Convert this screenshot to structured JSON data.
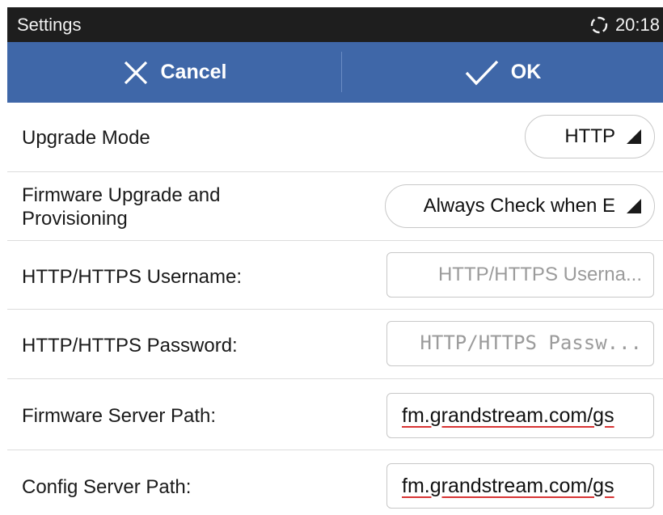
{
  "status_bar": {
    "title": "Settings",
    "time": "20:18",
    "sync_icon": "sync-icon"
  },
  "action_bar": {
    "cancel_label": "Cancel",
    "ok_label": "OK",
    "color": "#3f67a8"
  },
  "rows": {
    "upgrade_mode": {
      "label": "Upgrade Mode",
      "value": "HTTP"
    },
    "firmware_upgrade": {
      "label_line1": "Firmware Upgrade and",
      "label_line2": "Provisioning",
      "value": "Always Check when E"
    },
    "http_username": {
      "label": "HTTP/HTTPS Username:",
      "placeholder": "HTTP/HTTPS Userna...",
      "value": ""
    },
    "http_password": {
      "label": "HTTP/HTTPS Password:",
      "placeholder": "HTTP/HTTPS Passw...",
      "value": ""
    },
    "firmware_path": {
      "label": "Firmware Server Path:",
      "value": "fm.grandstream.com/gs"
    },
    "config_path": {
      "label": "Config Server Path:",
      "value": "fm.grandstream.com/gs"
    }
  }
}
